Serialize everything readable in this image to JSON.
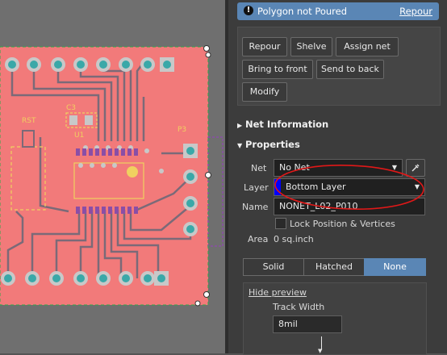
{
  "canvas": {
    "designators": {
      "rst": "RST",
      "c3": "C3",
      "u1": "U1",
      "p3": "P3"
    },
    "colors": {
      "board": "#f27a7a",
      "pad": "#c8c8c8",
      "pad_hole": "#3aa8a8",
      "trace": "#7b6a78",
      "outline": "#f0d060",
      "select": "#2ea84a",
      "violet": "#8a4ea6"
    }
  },
  "panel": {
    "banner": {
      "icon": "warning-icon",
      "text": "Polygon not Poured",
      "link": "Repour"
    },
    "buttons": {
      "repour": "Repour",
      "shelve": "Shelve",
      "assign_net": "Assign net",
      "bring_to_front": "Bring to front",
      "send_to_back": "Send to back",
      "modify": "Modify"
    },
    "sections": {
      "net_info": "Net Information",
      "properties": "Properties"
    },
    "props": {
      "net_label": "Net",
      "net_value": "No Net",
      "layer_label": "Layer",
      "layer_value": "Bottom Layer",
      "layer_color": "#0000ff",
      "name_label": "Name",
      "name_value": "NONET_L02_P010",
      "lock_label": "Lock Position & Vertices",
      "area_label": "Area",
      "area_value": "0 sq.inch"
    },
    "fill_modes": [
      "Solid",
      "Hatched",
      "None"
    ],
    "selected_fill": "None",
    "preview": {
      "hide_label": "Hide preview",
      "track_width_label": "Track Width",
      "track_width_value": "8mil"
    }
  }
}
